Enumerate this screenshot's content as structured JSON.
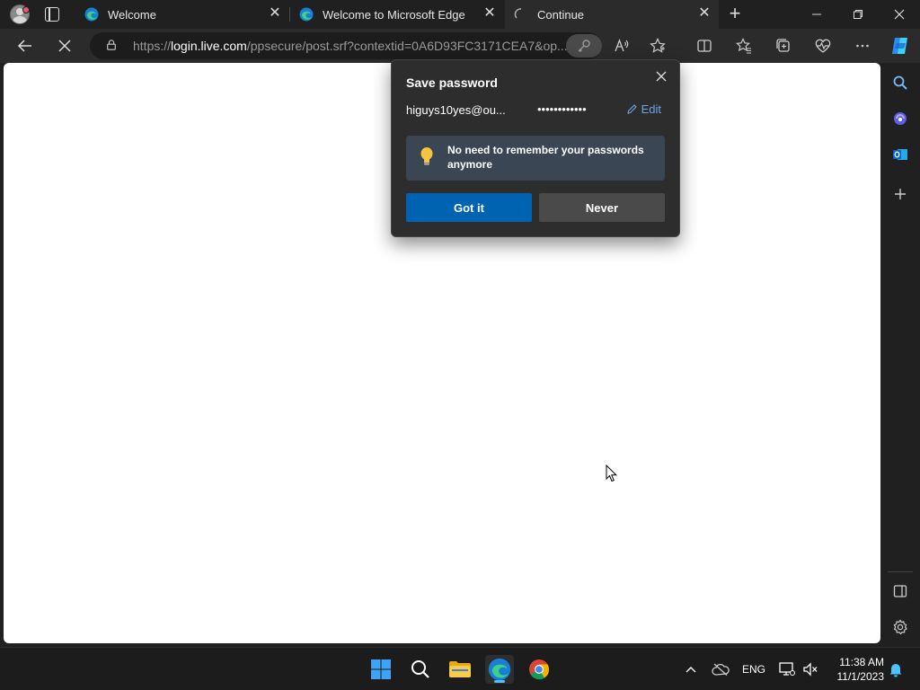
{
  "browser": {
    "tabs": [
      {
        "label": "Welcome",
        "favicon": "edge-icon",
        "active": false
      },
      {
        "label": "Welcome to Microsoft Edge",
        "favicon": "edge-icon",
        "active": false
      },
      {
        "label": "Continue",
        "favicon": "loading-spinner-icon",
        "active": true
      }
    ],
    "address": {
      "scheme": "https://",
      "host": "login.live.com",
      "path": "/ppsecure/post.srf?contextid=0A6D93FC3171CEA7&op..."
    }
  },
  "password_popup": {
    "title": "Save password",
    "username": "higuys10yes@ou...",
    "password_mask": "••••••••••••",
    "edit_label": "Edit",
    "info_message": "No need to remember your passwords anymore",
    "primary_button": "Got it",
    "secondary_button": "Never"
  },
  "taskbar": {
    "language": "ENG",
    "time": "11:38 AM",
    "date": "11/1/2023"
  },
  "colors": {
    "accent": "#0063b1",
    "link": "#6aa7e8",
    "info_bg": "#3b4654"
  }
}
